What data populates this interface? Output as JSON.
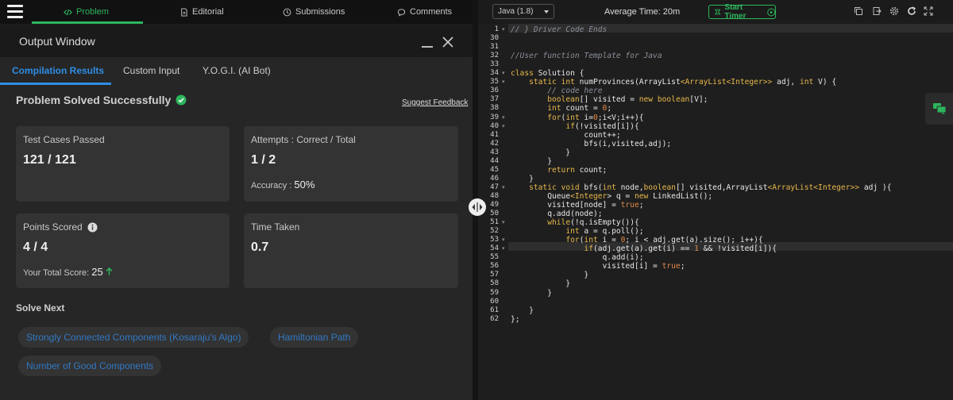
{
  "nav": {
    "tabs": [
      {
        "label": "Problem",
        "icon": "code-icon"
      },
      {
        "label": "Editorial",
        "icon": "document-icon"
      },
      {
        "label": "Submissions",
        "icon": "clock-icon"
      },
      {
        "label": "Comments",
        "icon": "chat-bubble-icon"
      }
    ]
  },
  "output_window": {
    "title": "Output Window",
    "tabs": [
      "Compilation Results",
      "Custom Input",
      "Y.O.G.I. (AI Bot)"
    ],
    "status": "Problem Solved Successfully",
    "feedback_link": "Suggest Feedback",
    "cards": {
      "test_cases": {
        "label": "Test Cases Passed",
        "value": "121 / 121"
      },
      "attempts": {
        "label": "Attempts : Correct / Total",
        "value": "1 / 2",
        "accuracy_label": "Accuracy :",
        "accuracy_value": "50%"
      },
      "points": {
        "label": "Points Scored",
        "value": "4 / 4",
        "total_label": "Your Total Score:",
        "total_value": "25"
      },
      "time": {
        "label": "Time Taken",
        "value": "0.7"
      }
    },
    "solve_next_heading": "Solve Next",
    "solve_next": [
      "Strongly Connected Components (Kosaraju's Algo)",
      "Hamiltonian Path",
      "Number of Good Components"
    ]
  },
  "editor_toolbar": {
    "language": "Java (1.8)",
    "average_time": "Average Time: 20m",
    "timer_button": "Start Timer"
  },
  "code": {
    "line_numbers": [
      "1",
      "30",
      "31",
      "32",
      "33",
      "34",
      "35",
      "36",
      "37",
      "38",
      "39",
      "40",
      "41",
      "42",
      "43",
      "44",
      "45",
      "46",
      "47",
      "48",
      "49",
      "50",
      "51",
      "52",
      "53",
      "54",
      "55",
      "56",
      "57",
      "58",
      "59",
      "60",
      "61",
      "62"
    ],
    "lines": [
      "// } Driver Code Ends",
      "",
      "",
      "//User function Template for Java",
      "",
      "class Solution {",
      "    static int numProvinces(ArrayList<ArrayList<Integer>> adj, int V) {",
      "        // code here",
      "        boolean[] visited = new boolean[V];",
      "        int count = 0;",
      "        for(int i=0;i<V;i++){",
      "            if(!visited[i]){",
      "                count++;",
      "                bfs(i,visited,adj);",
      "            }",
      "        }",
      "        return count;",
      "    }",
      "    static void bfs(int node,boolean[] visited,ArrayList<ArrayList<Integer>> adj ){",
      "        Queue<Integer> q = new LinkedList();",
      "        visited[node] = true;",
      "        q.add(node);",
      "        while(!q.isEmpty()){",
      "            int a = q.poll();",
      "            for(int i = 0; i < adj.get(a).size(); i++){",
      "                if(adj.get(a).get(i) == 1 && !visited[i]){",
      "                    q.add(i);",
      "                    visited[i] = true;",
      "                }",
      "            }",
      "        }",
      "",
      "    }",
      "};"
    ]
  },
  "colors": {
    "accent_green": "#2db55d",
    "accent_blue": "#2f8de4",
    "chip_text": "#3179c5"
  }
}
